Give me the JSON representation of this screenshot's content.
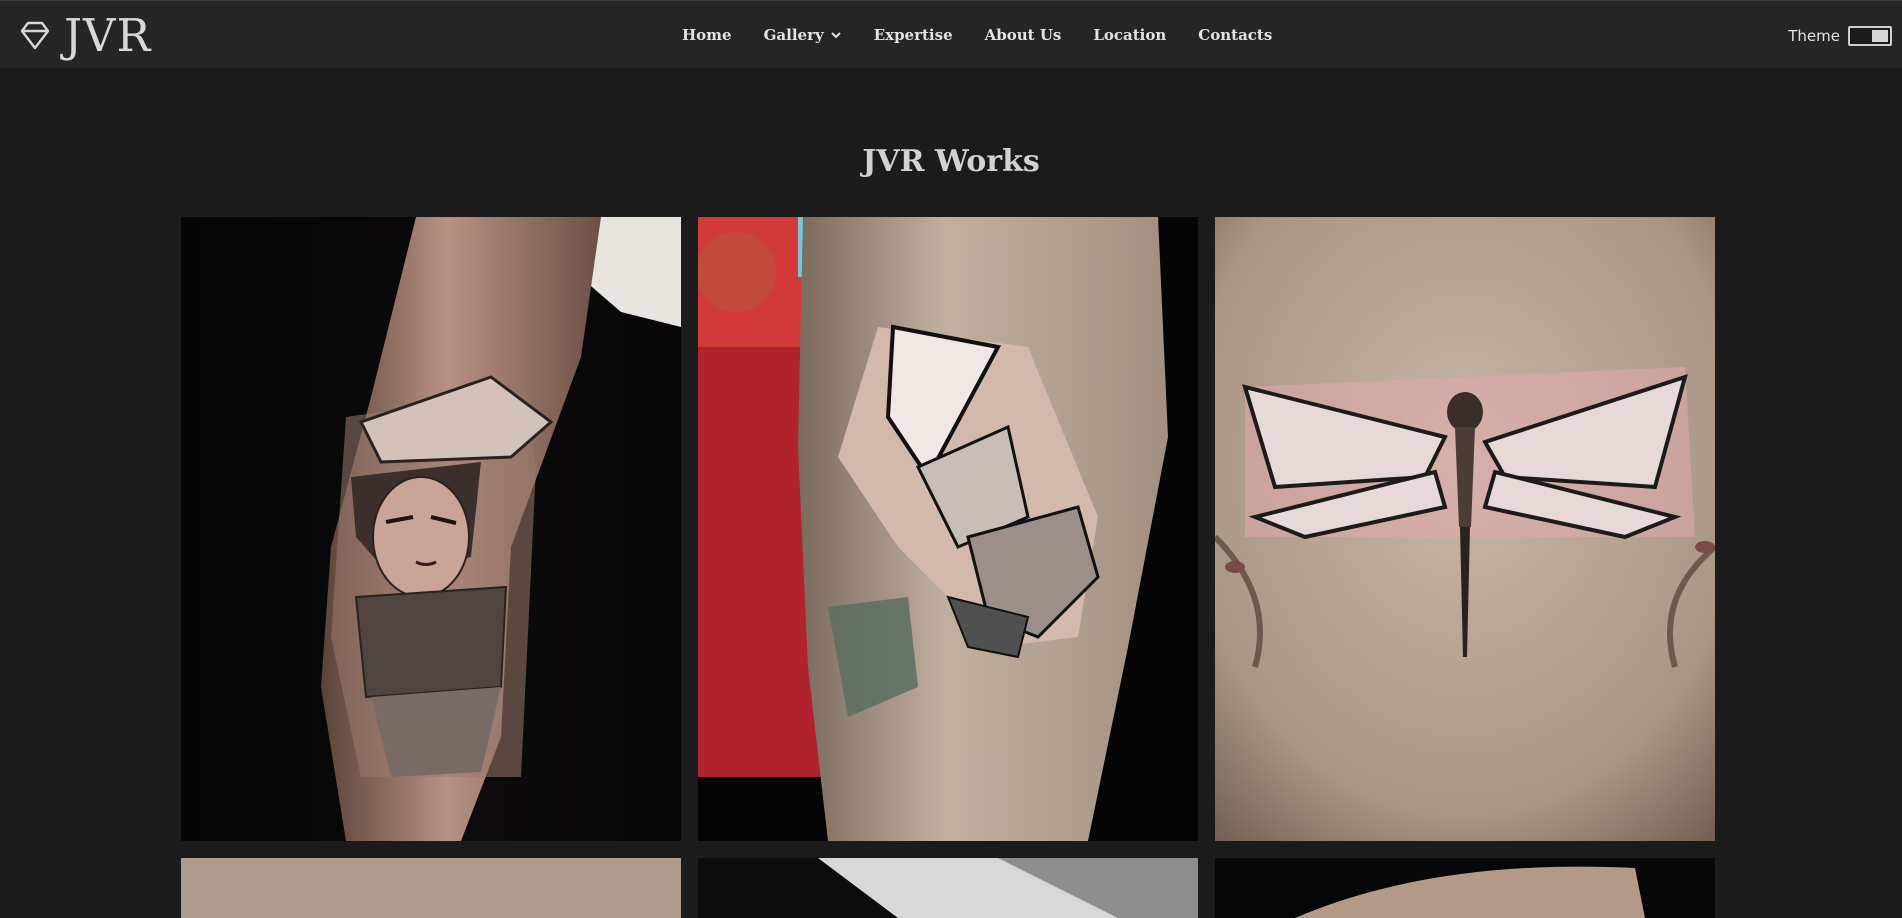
{
  "brand": {
    "name": "JVR",
    "logo_icon": "diamond-icon"
  },
  "nav": {
    "items": [
      {
        "label": "Home"
      },
      {
        "label": "Gallery",
        "icon": "chevron-down-icon"
      },
      {
        "label": "Expertise"
      },
      {
        "label": "About Us"
      },
      {
        "label": "Location"
      },
      {
        "label": "Contacts"
      }
    ]
  },
  "theme": {
    "label": "Theme",
    "toggle_state": "on"
  },
  "page": {
    "title": "JVR Works"
  },
  "gallery": {
    "items": [
      {
        "subject": "geisha-fox-mask-tattoo"
      },
      {
        "subject": "koi-fish-tattoo"
      },
      {
        "subject": "dragonfly-chest-tattoo"
      },
      {
        "subject": "tattoo-photo"
      },
      {
        "subject": "tattoo-photo"
      },
      {
        "subject": "tattoo-photo"
      }
    ]
  },
  "colors": {
    "background": "#1b1b1b",
    "navbar": "#252525",
    "text": "#e3e3e3"
  }
}
